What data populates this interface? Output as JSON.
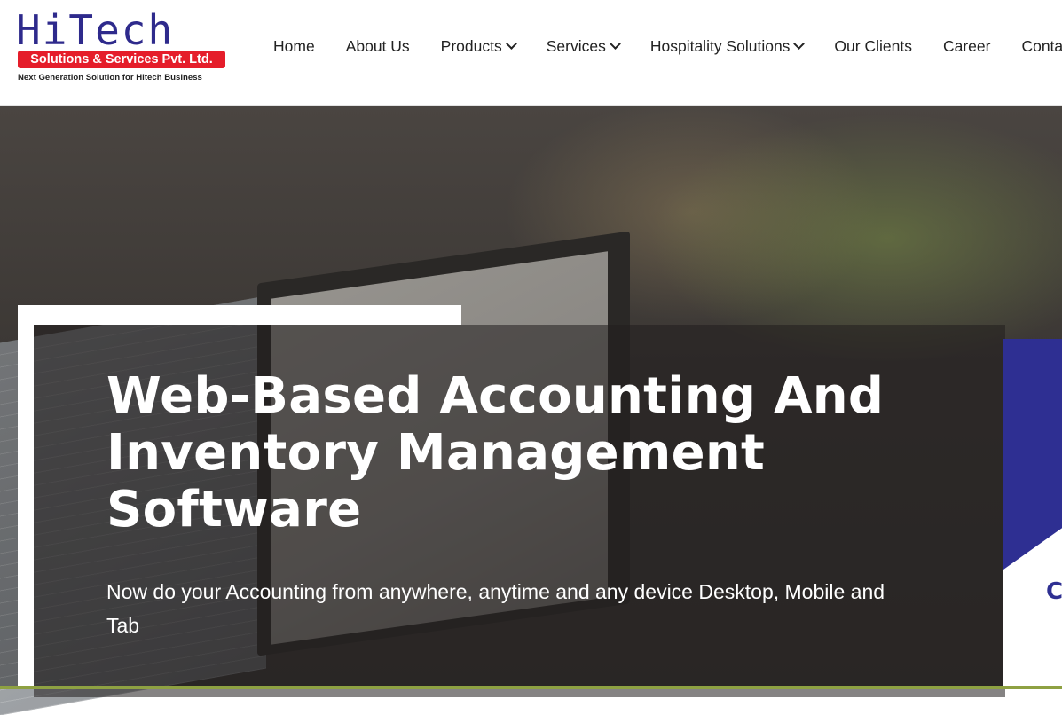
{
  "logo": {
    "word": "HiTech",
    "banner": "Solutions & Services Pvt. Ltd.",
    "tagline": "Next Generation Solution for Hitech Business"
  },
  "nav": {
    "items": [
      {
        "label": "Home"
      },
      {
        "label": "About Us"
      },
      {
        "label": "Products"
      },
      {
        "label": "Services"
      },
      {
        "label": "Hospitality Solutions"
      },
      {
        "label": "Our Clients"
      },
      {
        "label": "Career"
      },
      {
        "label": "Conta"
      }
    ]
  },
  "hero": {
    "title": "Web-Based Accounting And Inventory Management Software",
    "subtitle": "Now do your Accounting from anywhere, anytime and any device Desktop, Mobile and Tab"
  },
  "side_card": {
    "text": "Cl"
  },
  "colors": {
    "brand_blue": "#2e2a8c",
    "brand_red": "#e51d2a",
    "accent_blue": "#2e2f92",
    "bottom_line": "#8ea142"
  }
}
